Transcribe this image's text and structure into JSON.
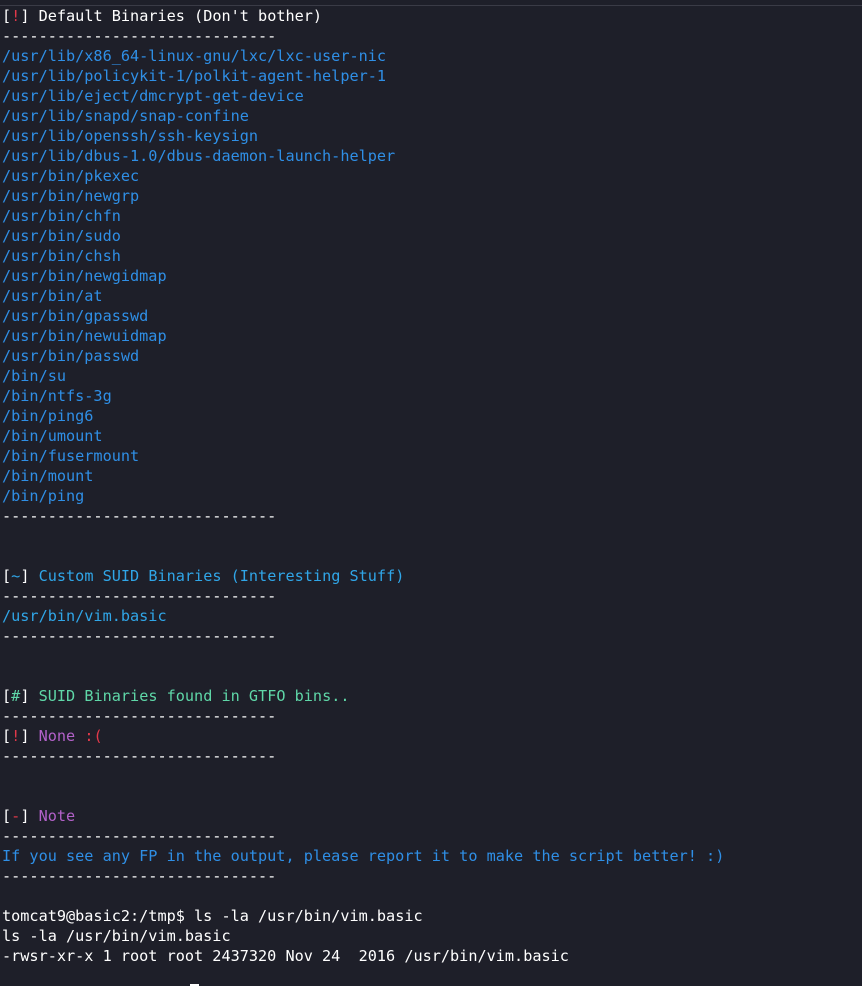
{
  "section_default": {
    "bracket_open": "[",
    "marker": "!",
    "bracket_close": "]",
    "title": " Default Binaries (Don't bother)",
    "separator": "------------------------------",
    "binaries": [
      "/usr/lib/x86_64-linux-gnu/lxc/lxc-user-nic",
      "/usr/lib/policykit-1/polkit-agent-helper-1",
      "/usr/lib/eject/dmcrypt-get-device",
      "/usr/lib/snapd/snap-confine",
      "/usr/lib/openssh/ssh-keysign",
      "/usr/lib/dbus-1.0/dbus-daemon-launch-helper",
      "/usr/bin/pkexec",
      "/usr/bin/newgrp",
      "/usr/bin/chfn",
      "/usr/bin/sudo",
      "/usr/bin/chsh",
      "/usr/bin/newgidmap",
      "/usr/bin/at",
      "/usr/bin/gpasswd",
      "/usr/bin/newuidmap",
      "/usr/bin/passwd",
      "/bin/su",
      "/bin/ntfs-3g",
      "/bin/ping6",
      "/bin/umount",
      "/bin/fusermount",
      "/bin/mount",
      "/bin/ping"
    ]
  },
  "section_custom": {
    "bracket_open": "[",
    "marker": "~",
    "bracket_close": "]",
    "title": " Custom SUID Binaries (Interesting Stuff)",
    "separator": "------------------------------",
    "binaries": [
      "/usr/bin/vim.basic"
    ]
  },
  "section_gtfo": {
    "bracket_open": "[",
    "marker": "#",
    "bracket_close": "]",
    "title": " SUID Binaries found in GTFO bins..",
    "separator": "------------------------------",
    "result_marker": "!",
    "result_none": " None ",
    "result_face": ":("
  },
  "section_note": {
    "bracket_open": "[",
    "marker": "-",
    "bracket_close": "]",
    "title": " Note",
    "separator": "------------------------------",
    "message": "If you see any FP in the output, please report it to make the script better! :)"
  },
  "shell": {
    "prompt": "tomcat9@basic2:/tmp$ ",
    "command": "ls -la /usr/bin/vim.basic",
    "echo": "ls -la /usr/bin/vim.basic",
    "output": "-rwsr-xr-x 1 root root 2437320 Nov 24  2016 /usr/bin/vim.basic"
  },
  "colors": {
    "background": "#1e1f29",
    "red": "#e0394a",
    "blue": "#2f8fe6",
    "cyan": "#30a6e8",
    "green": "#5fd7a8",
    "purple": "#b361c9"
  }
}
